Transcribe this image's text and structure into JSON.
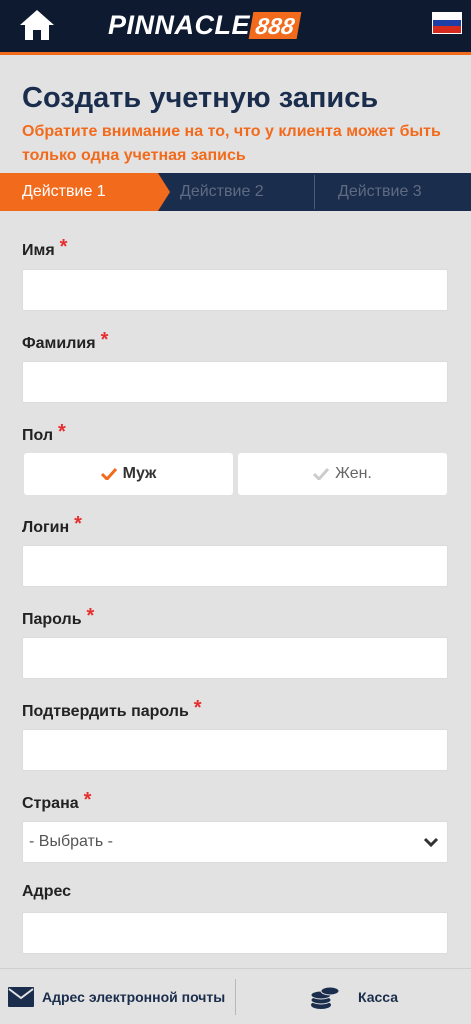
{
  "header": {
    "logo_text": "PINNACLE",
    "logo_number": "888",
    "flag_colors": [
      "#ffffff",
      "#1c3fa8",
      "#d52b1e"
    ],
    "accent_color": "#f26b1d",
    "bg_color": "#0d1a30"
  },
  "page": {
    "title": "Создать учетную запись",
    "subtitle": "Обратите внимание на то, что у клиента может быть только одна учетная запись"
  },
  "steps": [
    {
      "label": "Действие 1",
      "active": true
    },
    {
      "label": "Действие 2",
      "active": false
    },
    {
      "label": "Действие 3",
      "active": false
    }
  ],
  "form": {
    "required_mark": "*",
    "first_name": {
      "label": "Имя",
      "value": ""
    },
    "last_name": {
      "label": "Фамилия",
      "value": ""
    },
    "gender": {
      "label": "Пол",
      "options": [
        "Муж",
        "Жен."
      ],
      "selected": "Муж"
    },
    "login": {
      "label": "Логин",
      "value": ""
    },
    "password": {
      "label": "Пароль",
      "value": ""
    },
    "confirm_password": {
      "label": "Подтвердить пароль",
      "value": ""
    },
    "country": {
      "label": "Страна",
      "selected": "- Выбрать -"
    },
    "address": {
      "label": "Адрес",
      "value": ""
    }
  },
  "bottom_bar": {
    "email_label": "Адрес электронной почты",
    "cashier_label": "Касса"
  }
}
